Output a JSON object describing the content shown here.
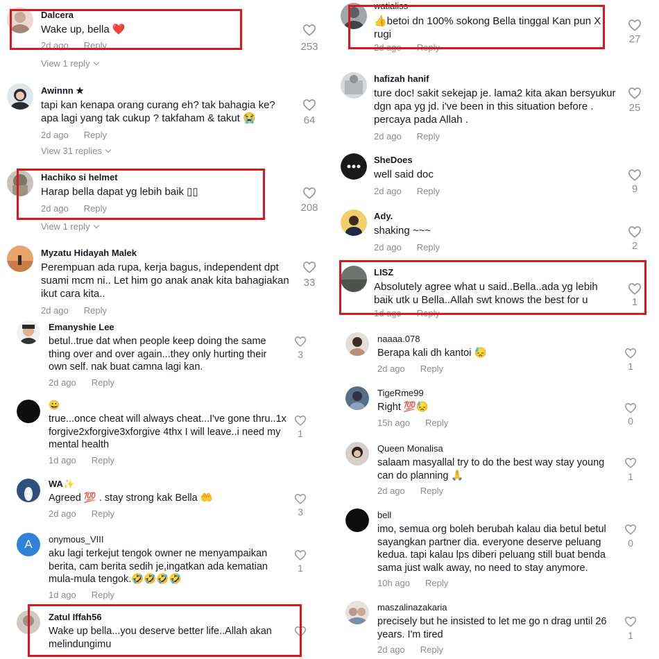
{
  "left_comments": [
    {
      "user": "Dalcera",
      "text": "Wake up, bella ❤️",
      "date": "2d ago",
      "reply": "Reply",
      "likes": "253",
      "view_replies": "View 1 reply"
    },
    {
      "user": "Awinnn ★",
      "text": "tapi kan kenapa orang curang eh? tak bahagia ke? apa lagi yang tak cukup ? takfaham & takut 😭",
      "date": "2d ago",
      "reply": "Reply",
      "likes": "64",
      "view_replies": "View 31 replies"
    },
    {
      "user": "Hachiko si helmet",
      "text": "Harap bella dapat yg lebih baik ▯▯",
      "date": "2d ago",
      "reply": "Reply",
      "likes": "208",
      "view_replies": "View 1 reply"
    },
    {
      "user": "Myzatu Hidayah Malek",
      "text": "Perempuan ada rupa, kerja bagus, independent dpt suami mcm ni.. Let him go anak anak kita bahagiakan ikut cara kita..",
      "date": "2d ago",
      "reply": "Reply",
      "likes": "33"
    },
    {
      "user": "Emanyshie Lee",
      "text": "betul..true dat when people keep doing the same thing over and over again...they only hurting their own self. nak buat camna lagi kan.",
      "date": "2d ago",
      "reply": "Reply",
      "likes": "3"
    },
    {
      "user": "😀",
      "text": "true...once cheat will always cheat...I've gone thru..1x forgive2xforgive3xforgive 4thx I will leave..i need my mental health",
      "date": "1d ago",
      "reply": "Reply",
      "likes": "1"
    },
    {
      "user": "WA✨",
      "text": "Agreed 💯 . stay strong kak Bella 🤲",
      "date": "2d ago",
      "reply": "Reply",
      "likes": "3"
    },
    {
      "user": "onymous_VIII",
      "text": "aku lagi terkejut tengok owner ne menyampaikan berita, cam berita sedih je,ingatkan ada kematian mula-mula tengok.🤣🤣🤣🤣",
      "date": "1d ago",
      "reply": "Reply",
      "likes": "1",
      "avatar_letter": "A"
    },
    {
      "user": "Zatul Iffah56",
      "text": "Wake up bella...you deserve better life..Allah akan melindungimu",
      "date": "",
      "reply": "",
      "likes": ""
    }
  ],
  "right_comments": [
    {
      "user": "watialiss",
      "text": "👍betoi dn 100% sokong Bella tinggal Kan pun X rugi",
      "date": "2d ago",
      "reply": "Reply",
      "likes": "27"
    },
    {
      "user": "hafizah hanif",
      "text": "ture doc! sakit sekejap je. lama2 kita akan bersyukur dgn apa yg jd. i've been in this situation before . percaya pada Allah .",
      "date": "2d ago",
      "reply": "Reply",
      "likes": "25"
    },
    {
      "user": "SheDoes",
      "text": "well said doc",
      "date": "2d ago",
      "reply": "Reply",
      "likes": "9"
    },
    {
      "user": "Ady.",
      "text": "shaking ~~~",
      "date": "2d ago",
      "reply": "Reply",
      "likes": "2"
    },
    {
      "user": "LISZ",
      "text": "Absolutely agree what u said..Bella..ada yg lebih baik utk u Bella..Allah swt knows the best for u",
      "date": "1d ago",
      "reply": "Reply",
      "likes": "1"
    },
    {
      "user": "naaaa.078",
      "text": "Berapa kali dh kantoi 😓",
      "date": "2d ago",
      "reply": "Reply",
      "likes": "1"
    },
    {
      "user": "TigeRme99",
      "text": "Right 💯😓",
      "date": "15h ago",
      "reply": "Reply",
      "likes": "0"
    },
    {
      "user": "Queen Monalisa",
      "text": "salaam masyallal try to do the best way stay young can do planning 🙏",
      "date": "2d ago",
      "reply": "Reply",
      "likes": "1"
    },
    {
      "user": "bell",
      "text": "imo, semua org boleh berubah kalau dia betul betul sayangkan partner dia. everyone deserve peluang kedua. tapi kalau lps diberi peluang still buat benda sama just walk away, no need to stay anymore.",
      "date": "10h ago",
      "reply": "Reply",
      "likes": "0"
    },
    {
      "user": "maszalinazakaria",
      "text": "precisely but he insisted to let me go n drag until 26 years. I'm tired",
      "date": "2d ago",
      "reply": "Reply",
      "likes": "1"
    }
  ],
  "colors": {
    "highlight_box": "#d9171d",
    "meta_text": "#8a8b91",
    "text": "#161823"
  },
  "icons": {
    "like": "heart-outline-icon",
    "expand": "chevron-down-icon"
  }
}
